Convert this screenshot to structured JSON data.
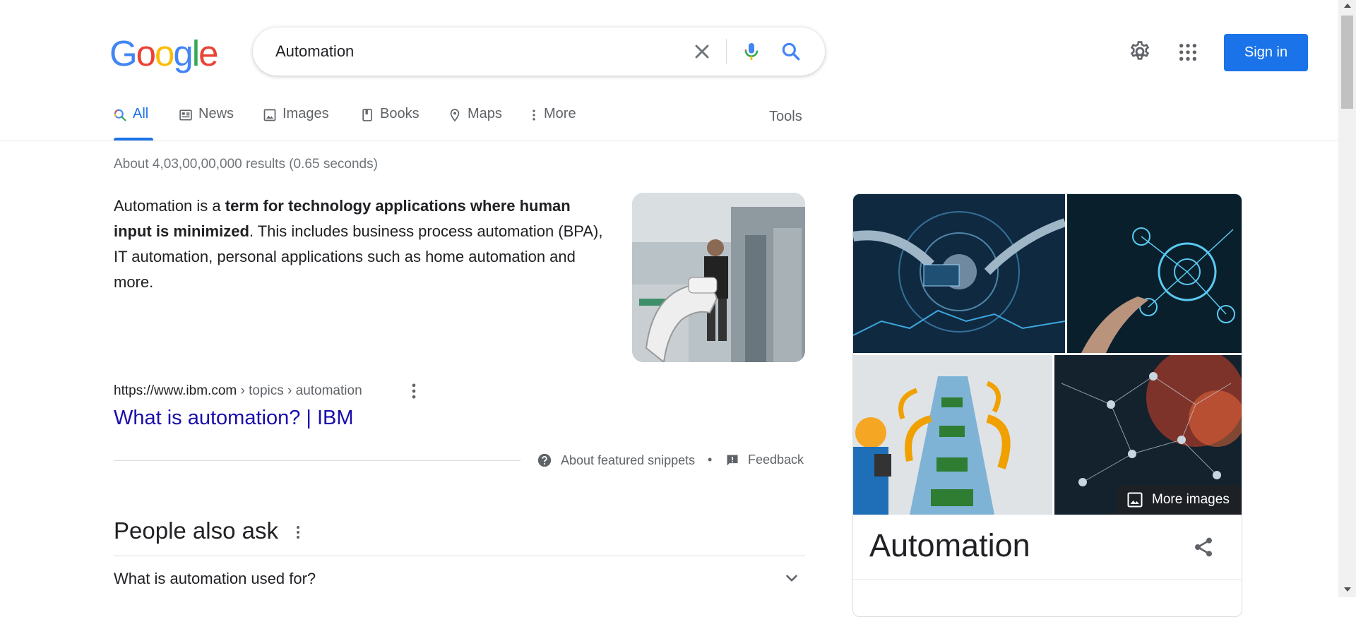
{
  "logo": {
    "letters": [
      "G",
      "o",
      "o",
      "g",
      "l",
      "e"
    ]
  },
  "search": {
    "query": "Automation"
  },
  "header": {
    "sign_in_label": "Sign in"
  },
  "tabs": [
    {
      "label": "All",
      "icon": "search-icon",
      "active": true
    },
    {
      "label": "News",
      "icon": "news-icon"
    },
    {
      "label": "Images",
      "icon": "image-icon"
    },
    {
      "label": "Books",
      "icon": "book-icon"
    },
    {
      "label": "Maps",
      "icon": "map-pin-icon"
    },
    {
      "label": "More",
      "icon": "more-vert-icon"
    }
  ],
  "tools_label": "Tools",
  "result_stats": "About 4,03,00,00,000 results (0.65 seconds)",
  "featured_snippet": {
    "text_intro": "Automation is a ",
    "text_bold": "term for technology applications where human input is minimized",
    "text_rest": ". This includes business process automation (BPA), IT automation, personal applications such as home automation and more.",
    "cite_domain": "https://www.ibm.com",
    "cite_path": " › topics › automation",
    "title": "What is automation? | IBM",
    "about_label": "About featured snippets",
    "separator": "•",
    "feedback_label": "Feedback"
  },
  "people_also_ask": {
    "title": "People also ask",
    "questions": [
      "What is automation used for?"
    ]
  },
  "knowledge_panel": {
    "title": "Automation",
    "more_images_label": "More images"
  },
  "colors": {
    "accent": "#1a73e8",
    "link": "#1a0dab",
    "text": "#202124",
    "muted": "#5f6368"
  }
}
